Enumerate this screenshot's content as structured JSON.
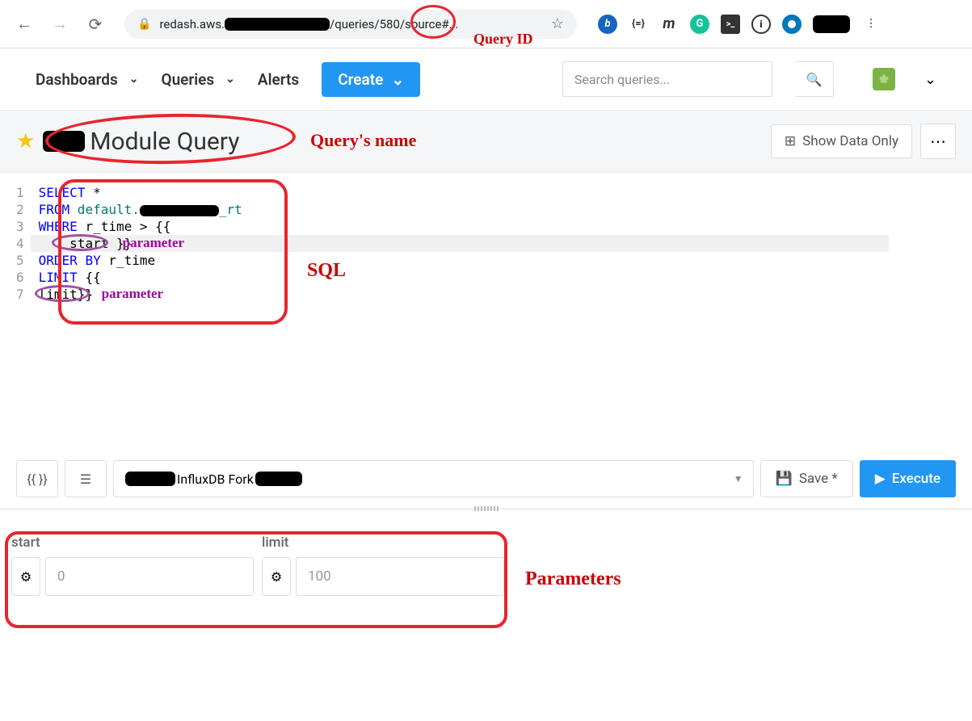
{
  "browser": {
    "url_prefix": "redash.aws.",
    "url_mid": "/queries",
    "url_id": "/580/",
    "url_suffix": "source#...",
    "annotation_query_id": "Query ID"
  },
  "nav": {
    "dashboards": "Dashboards",
    "queries": "Queries",
    "alerts": "Alerts",
    "create": "Create",
    "search_placeholder": "Search queries..."
  },
  "header": {
    "title": "Module Query",
    "show_data": "Show Data Only",
    "annotation_name": "Query's name"
  },
  "editor": {
    "lines": [
      "1",
      "2",
      "3",
      "4",
      "5",
      "6",
      "7"
    ],
    "annotation_sql": "SQL",
    "annotation_param": "parameter",
    "code": {
      "l1_kw": "SELECT",
      "l1_rest": " *",
      "l2_kw": "FROM",
      "l2_ident": " default.",
      "l2_suffix": "_rt",
      "l3_kw": "WHERE",
      "l3_rest": " r_time > {{",
      "l4": "    start }}",
      "l5_kw": "ORDER BY",
      "l5_rest": " r_time",
      "l6_kw": "LIMIT",
      "l6_rest": " {{",
      "l7": "limit}}"
    }
  },
  "toolbar": {
    "braces": "{{ }}",
    "datasource": "InfluxDB Fork",
    "save": "Save *",
    "execute": "Execute"
  },
  "params": {
    "p1_label": "start",
    "p1_value": "0",
    "p2_label": "limit",
    "p2_value": "100",
    "annotation": "Parameters"
  }
}
